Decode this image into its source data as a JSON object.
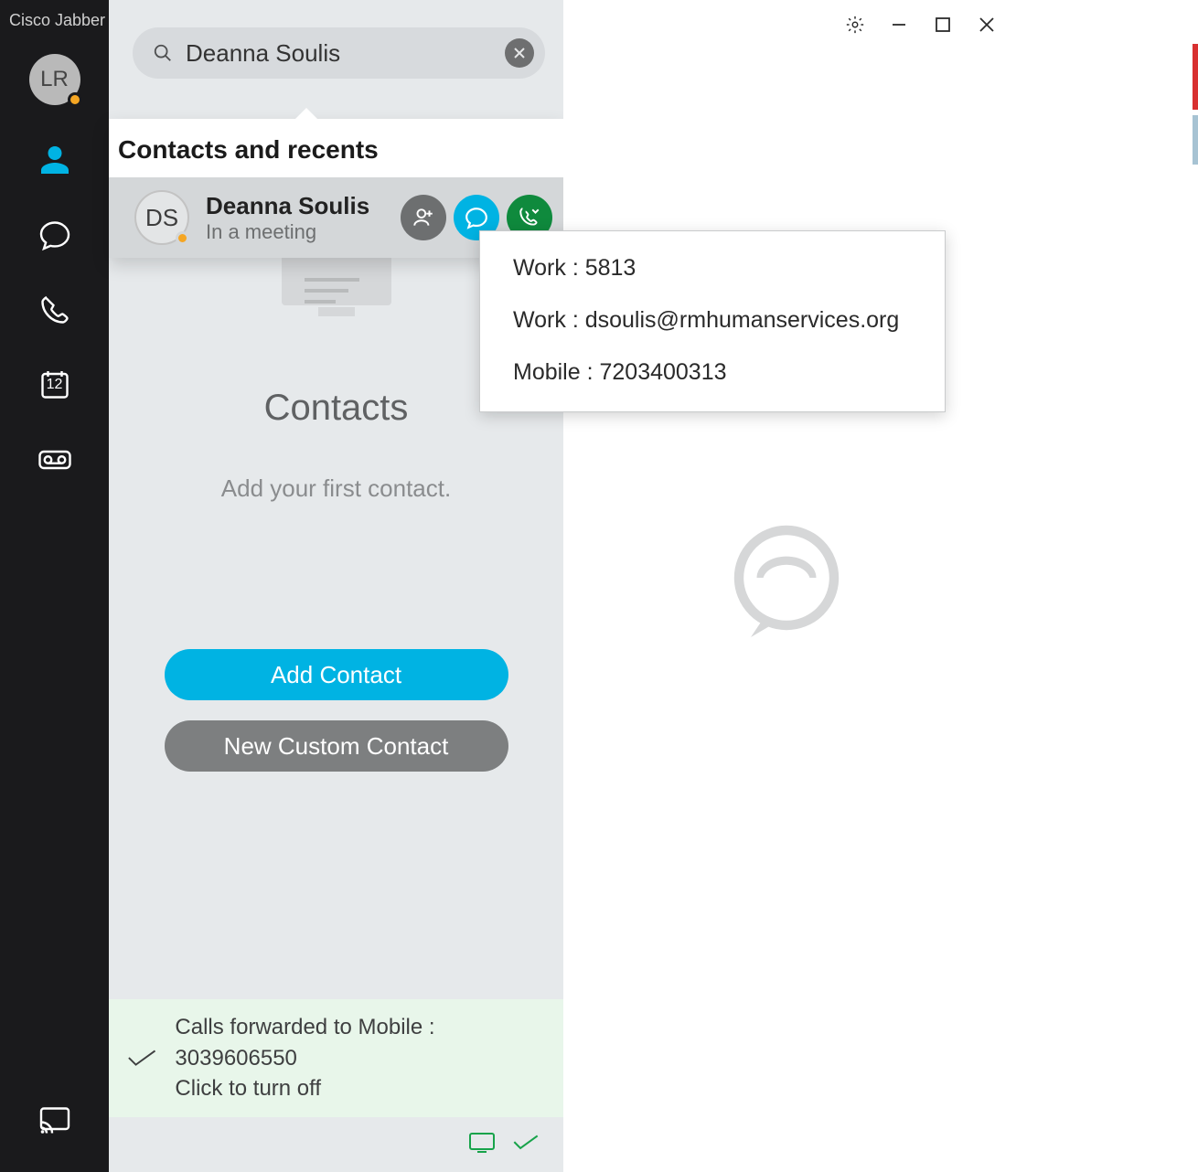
{
  "app_title": "Cisco Jabber",
  "user": {
    "initials": "LR"
  },
  "sidebar": {
    "calendar_day": "12"
  },
  "search": {
    "value": "Deanna Soulis"
  },
  "popup": {
    "title": "Contacts and recents",
    "result": {
      "initials": "DS",
      "name": "Deanna Soulis",
      "status": "In a meeting"
    }
  },
  "details": {
    "work_phone_label": "Work : ",
    "work_phone": "5813",
    "work_email_label": "Work : ",
    "work_email": "dsoulis@rmhumanservices.org",
    "mobile_label": "Mobile : ",
    "mobile": "7203400313"
  },
  "contacts_pane": {
    "heading": "Contacts",
    "subtext": "Add your first contact.",
    "add_button": "Add Contact",
    "custom_button": "New Custom Contact"
  },
  "forward": {
    "line1": "Calls forwarded to Mobile : 3039606550",
    "line2": "Click to turn off"
  }
}
